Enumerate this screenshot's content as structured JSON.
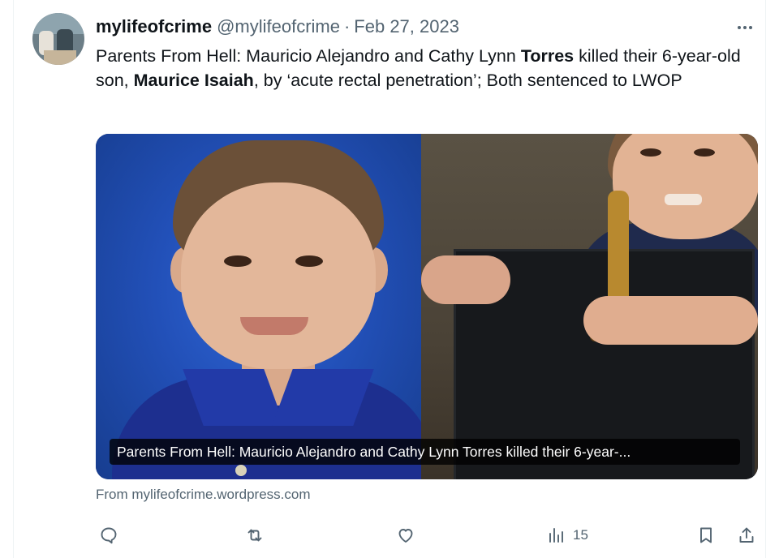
{
  "tweet": {
    "display_name": "mylifeofcrime",
    "handle": "@mylifeofcrime",
    "separator": "·",
    "date": "Feb 27, 2023",
    "text_parts": {
      "p1": "Parents From Hell: Mauricio Alejandro and Cathy Lynn ",
      "b1": "Torres",
      "p2": " killed their 6-year-old son, ",
      "b2": "Maurice Isaiah",
      "p3": ", by ‘acute rectal penetration’; Both sentenced to LWOP"
    },
    "card": {
      "caption": "Parents From Hell: Mauricio Alejandro and Cathy Lynn Torres killed their 6-year-...",
      "source": "From mylifeofcrime.wordpress.com"
    },
    "actions": {
      "reply_icon": "reply-icon",
      "retweet_icon": "retweet-icon",
      "like_icon": "heart-icon",
      "views_icon": "views-icon",
      "views_count": "15",
      "bookmark_icon": "bookmark-icon",
      "share_icon": "share-icon"
    },
    "more_icon": "more-options-icon"
  }
}
